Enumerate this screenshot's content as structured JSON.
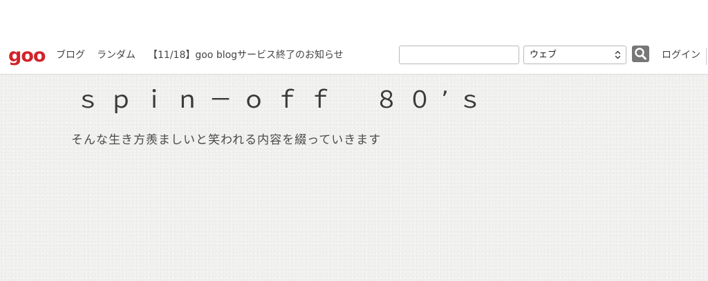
{
  "header": {
    "logo_text": "goo",
    "nav": {
      "blog": "ブログ",
      "random": "ランダム",
      "notice": "【11/18】goo blogサービス終了のお知らせ"
    },
    "search": {
      "value": "",
      "placeholder": "",
      "select_value": "ウェブ"
    },
    "login": "ログイン"
  },
  "blog": {
    "title": "ｓｐｉｎ－ｏｆｆ　８０’ｓ",
    "subtitle": "そんな生き方羨ましいと笑われる内容を綴っていきます"
  },
  "colors": {
    "logo": "#d2232a",
    "header_background": "#f1f1f0",
    "nav_text": "#444444",
    "search_button": "#777777"
  },
  "icons": {
    "search": "search-icon",
    "select_arrows": "chevron-up-down-icon"
  }
}
